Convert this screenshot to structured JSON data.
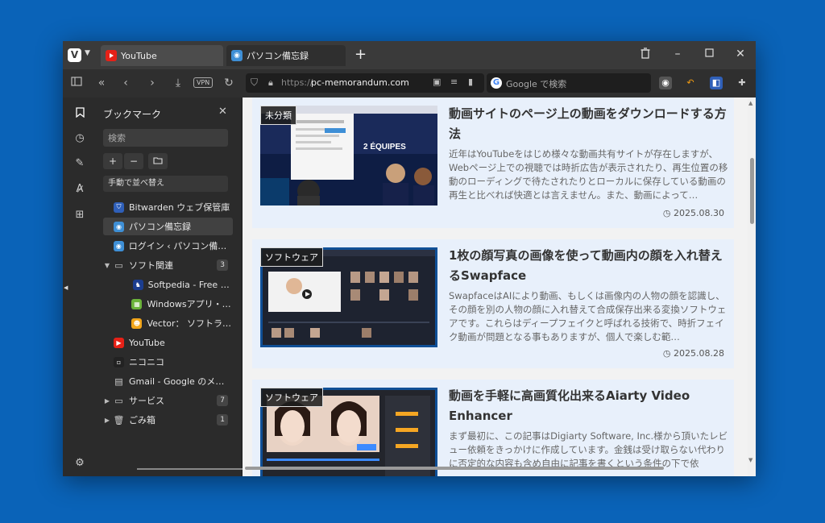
{
  "tabs": [
    {
      "label": "YouTube",
      "favicon": "youtube-icon",
      "active": true
    },
    {
      "label": "パソコン備忘録",
      "favicon": "pc-memo-icon",
      "active": false
    }
  ],
  "address": {
    "protocol": "https://",
    "host": "pc-memorandum.com",
    "search_placeholder": "Google で検索"
  },
  "toolbar": {
    "vpn_label": "VPN"
  },
  "panel": {
    "title": "ブックマーク",
    "search_placeholder": "検索",
    "add_label": "+",
    "remove_label": "−",
    "sort_label": "手動で並べ替え",
    "items": [
      {
        "label": "Bitwarden ウェブ保管庫",
        "icon": "bitwarden-icon",
        "level": 1
      },
      {
        "label": "パソコン備忘録",
        "icon": "pc-memo-icon",
        "level": 1,
        "selected": true
      },
      {
        "label": "ログイン ‹ パソコン備忘...",
        "icon": "pc-memo-icon",
        "level": 1
      },
      {
        "label": "ソフト関連",
        "icon": "folder-icon",
        "level": 1,
        "folder": true,
        "expanded": true,
        "count": "3"
      },
      {
        "label": "Softpedia - Free D...",
        "icon": "softpedia-icon",
        "level": 2
      },
      {
        "label": "Windowsアプリ・フリ...",
        "icon": "windowsapp-icon",
        "level": 2
      },
      {
        "label": "Vector： ソフトライブ...",
        "icon": "vector-icon",
        "level": 2
      },
      {
        "label": "YouTube",
        "icon": "youtube-icon",
        "level": 1
      },
      {
        "label": "ニコニコ",
        "icon": "niconico-icon",
        "level": 1
      },
      {
        "label": "Gmail - Google のメール",
        "icon": "document-icon",
        "level": 1
      },
      {
        "label": "サービス",
        "icon": "folder-icon",
        "level": 1,
        "folder": true,
        "expanded": false,
        "count": "7"
      },
      {
        "label": "ごみ箱",
        "icon": "trash-icon",
        "level": 1,
        "folder": true,
        "expanded": false,
        "count": "1"
      }
    ]
  },
  "articles": [
    {
      "category": "未分類",
      "title": "動画サイトのページ上の動画をダウンロードする方法",
      "excerpt": "近年はYouTubeをはじめ様々な動画共有サイトが存在しますが、Webページ上での視聴では時折広告が表示されたり、再生位置の移動のローディングで待たされたりとローカルに保存している動画の再生と比べれば快適とは言えません。また、動画によって…",
      "date": "2025.08.30",
      "thumb_text": "2 ÉQUIPES"
    },
    {
      "category": "ソフトウェア",
      "title": "1枚の顔写真の画像を使って動画内の顔を入れ替えるSwapface",
      "excerpt": "SwapfaceはAIにより動画、もしくは画像内の人物の顔を認識し、その顔を別の人物の顔に入れ替えて合成保存出来る変換ソフトウェアです。これらはディープフェイクと呼ばれる技術で、時折フェイク動画が問題となる事もありますが、個人で楽しむ範…",
      "date": "2025.08.28"
    },
    {
      "category": "ソフトウェア",
      "title": "動画を手軽に高画質化出来るAiarty Video Enhancer",
      "excerpt": "まず最初に、この記事はDigiarty Software, Inc.様から頂いたレビュー依頼をきっかけに作成しています。金銭は受け取らない代わりに否定的な内容も含め自由に記事を書くという条件の下で依",
      "date": ""
    }
  ]
}
